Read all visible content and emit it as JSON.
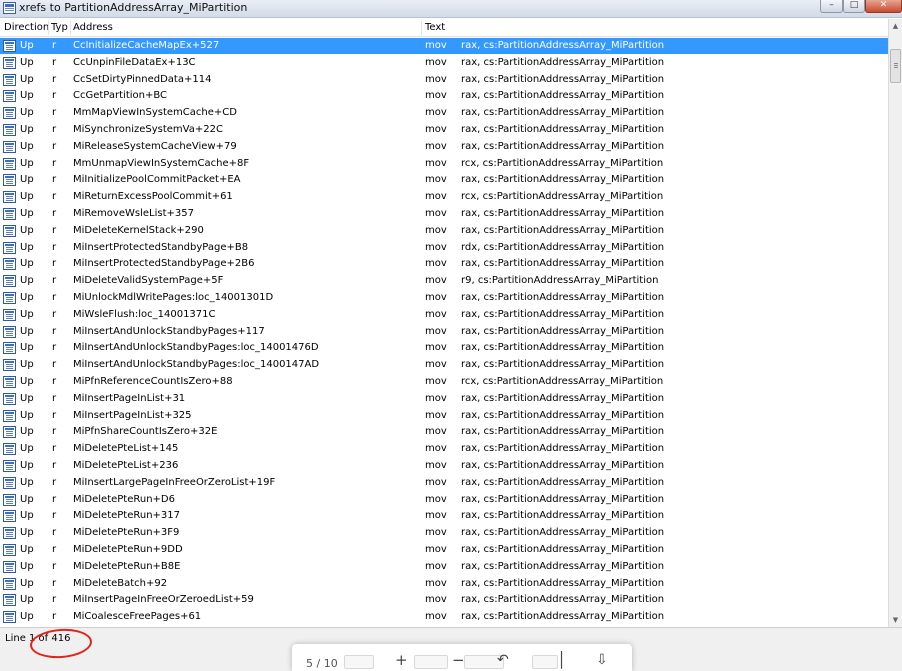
{
  "window": {
    "title": "xrefs to PartitionAddressArray_MiPartition",
    "minimize": "–",
    "maximize": "□",
    "close": "✕"
  },
  "columns": {
    "direction": "Direction",
    "type": "Typ",
    "address": "Address",
    "text": "Text"
  },
  "rows": [
    {
      "direction": "Up",
      "type": "r",
      "address": "CcInitializeCacheMapEx+527",
      "mnemonic": "mov",
      "operands": "rax, cs:PartitionAddressArray_MiPartition",
      "selected": true
    },
    {
      "direction": "Up",
      "type": "r",
      "address": "CcUnpinFileDataEx+13C",
      "mnemonic": "mov",
      "operands": "rax, cs:PartitionAddressArray_MiPartition"
    },
    {
      "direction": "Up",
      "type": "r",
      "address": "CcSetDirtyPinnedData+114",
      "mnemonic": "mov",
      "operands": "rax, cs:PartitionAddressArray_MiPartition"
    },
    {
      "direction": "Up",
      "type": "r",
      "address": "CcGetPartition+BC",
      "mnemonic": "mov",
      "operands": "rax, cs:PartitionAddressArray_MiPartition"
    },
    {
      "direction": "Up",
      "type": "r",
      "address": "MmMapViewInSystemCache+CD",
      "mnemonic": "mov",
      "operands": "rax, cs:PartitionAddressArray_MiPartition"
    },
    {
      "direction": "Up",
      "type": "r",
      "address": "MiSynchronizeSystemVa+22C",
      "mnemonic": "mov",
      "operands": "rax, cs:PartitionAddressArray_MiPartition"
    },
    {
      "direction": "Up",
      "type": "r",
      "address": "MiReleaseSystemCacheView+79",
      "mnemonic": "mov",
      "operands": "rax, cs:PartitionAddressArray_MiPartition"
    },
    {
      "direction": "Up",
      "type": "r",
      "address": "MmUnmapViewInSystemCache+8F",
      "mnemonic": "mov",
      "operands": "rcx, cs:PartitionAddressArray_MiPartition"
    },
    {
      "direction": "Up",
      "type": "r",
      "address": "MiInitializePoolCommitPacket+EA",
      "mnemonic": "mov",
      "operands": "rax, cs:PartitionAddressArray_MiPartition"
    },
    {
      "direction": "Up",
      "type": "r",
      "address": "MiReturnExcessPoolCommit+61",
      "mnemonic": "mov",
      "operands": "rcx, cs:PartitionAddressArray_MiPartition"
    },
    {
      "direction": "Up",
      "type": "r",
      "address": "MiRemoveWsleList+357",
      "mnemonic": "mov",
      "operands": "rax, cs:PartitionAddressArray_MiPartition"
    },
    {
      "direction": "Up",
      "type": "r",
      "address": "MiDeleteKernelStack+290",
      "mnemonic": "mov",
      "operands": "rax, cs:PartitionAddressArray_MiPartition"
    },
    {
      "direction": "Up",
      "type": "r",
      "address": "MiInsertProtectedStandbyPage+B8",
      "mnemonic": "mov",
      "operands": "rdx, cs:PartitionAddressArray_MiPartition"
    },
    {
      "direction": "Up",
      "type": "r",
      "address": "MiInsertProtectedStandbyPage+2B6",
      "mnemonic": "mov",
      "operands": "rax, cs:PartitionAddressArray_MiPartition"
    },
    {
      "direction": "Up",
      "type": "r",
      "address": "MiDeleteValidSystemPage+5F",
      "mnemonic": "mov",
      "operands": "r9, cs:PartitionAddressArray_MiPartition"
    },
    {
      "direction": "Up",
      "type": "r",
      "address": "MiUnlockMdlWritePages:loc_14001301D",
      "mnemonic": "mov",
      "operands": "rax, cs:PartitionAddressArray_MiPartition"
    },
    {
      "direction": "Up",
      "type": "r",
      "address": "MiWsleFlush:loc_14001371C",
      "mnemonic": "mov",
      "operands": "rax, cs:PartitionAddressArray_MiPartition"
    },
    {
      "direction": "Up",
      "type": "r",
      "address": "MiInsertAndUnlockStandbyPages+117",
      "mnemonic": "mov",
      "operands": "rax, cs:PartitionAddressArray_MiPartition"
    },
    {
      "direction": "Up",
      "type": "r",
      "address": "MiInsertAndUnlockStandbyPages:loc_14001476D",
      "mnemonic": "mov",
      "operands": "rax, cs:PartitionAddressArray_MiPartition"
    },
    {
      "direction": "Up",
      "type": "r",
      "address": "MiInsertAndUnlockStandbyPages:loc_1400147AD",
      "mnemonic": "mov",
      "operands": "rax, cs:PartitionAddressArray_MiPartition"
    },
    {
      "direction": "Up",
      "type": "r",
      "address": "MiPfnReferenceCountIsZero+88",
      "mnemonic": "mov",
      "operands": "rcx, cs:PartitionAddressArray_MiPartition"
    },
    {
      "direction": "Up",
      "type": "r",
      "address": "MiInsertPageInList+31",
      "mnemonic": "mov",
      "operands": "rax, cs:PartitionAddressArray_MiPartition"
    },
    {
      "direction": "Up",
      "type": "r",
      "address": "MiInsertPageInList+325",
      "mnemonic": "mov",
      "operands": "rax, cs:PartitionAddressArray_MiPartition"
    },
    {
      "direction": "Up",
      "type": "r",
      "address": "MiPfnShareCountIsZero+32E",
      "mnemonic": "mov",
      "operands": "rax, cs:PartitionAddressArray_MiPartition"
    },
    {
      "direction": "Up",
      "type": "r",
      "address": "MiDeletePteList+145",
      "mnemonic": "mov",
      "operands": "rax, cs:PartitionAddressArray_MiPartition"
    },
    {
      "direction": "Up",
      "type": "r",
      "address": "MiDeletePteList+236",
      "mnemonic": "mov",
      "operands": "rax, cs:PartitionAddressArray_MiPartition"
    },
    {
      "direction": "Up",
      "type": "r",
      "address": "MiInsertLargePageInFreeOrZeroList+19F",
      "mnemonic": "mov",
      "operands": "rax, cs:PartitionAddressArray_MiPartition"
    },
    {
      "direction": "Up",
      "type": "r",
      "address": "MiDeletePteRun+D6",
      "mnemonic": "mov",
      "operands": "rax, cs:PartitionAddressArray_MiPartition"
    },
    {
      "direction": "Up",
      "type": "r",
      "address": "MiDeletePteRun+317",
      "mnemonic": "mov",
      "operands": "rax, cs:PartitionAddressArray_MiPartition"
    },
    {
      "direction": "Up",
      "type": "r",
      "address": "MiDeletePteRun+3F9",
      "mnemonic": "mov",
      "operands": "rax, cs:PartitionAddressArray_MiPartition"
    },
    {
      "direction": "Up",
      "type": "r",
      "address": "MiDeletePteRun+9DD",
      "mnemonic": "mov",
      "operands": "rax, cs:PartitionAddressArray_MiPartition"
    },
    {
      "direction": "Up",
      "type": "r",
      "address": "MiDeletePteRun+B8E",
      "mnemonic": "mov",
      "operands": "rax, cs:PartitionAddressArray_MiPartition"
    },
    {
      "direction": "Up",
      "type": "r",
      "address": "MiDeleteBatch+92",
      "mnemonic": "mov",
      "operands": "rax, cs:PartitionAddressArray_MiPartition"
    },
    {
      "direction": "Up",
      "type": "r",
      "address": "MiInsertPageInFreeOrZeroedList+59",
      "mnemonic": "mov",
      "operands": "rax, cs:PartitionAddressArray_MiPartition"
    },
    {
      "direction": "Up",
      "type": "r",
      "address": "MiCoalesceFreePages+61",
      "mnemonic": "mov",
      "operands": "rax, cs:PartitionAddressArray_MiPartition"
    }
  ],
  "status": {
    "text": "Line 1 of 416"
  },
  "viewer_toolbar": {
    "page": "5 / 10",
    "zoom_in": "+",
    "zoom_out": "−"
  },
  "colors": {
    "selection": "#3399ff",
    "annotation": "#e2231a"
  }
}
